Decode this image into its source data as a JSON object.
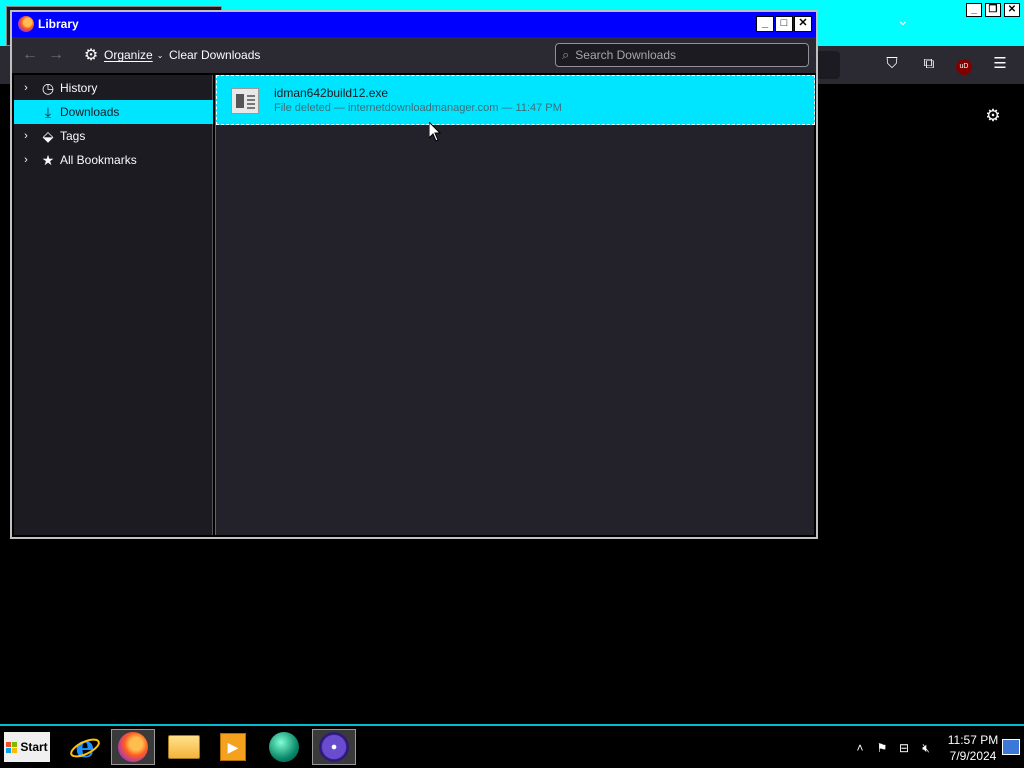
{
  "background_window": {
    "icons": [
      "chevron-down-icon",
      "pocket-icon",
      "extensions-icon",
      "ublock-icon",
      "hamburger-menu-icon",
      "gear-icon"
    ],
    "ublock_badge": "uD"
  },
  "library": {
    "title": "Library",
    "toolbar": {
      "back_icon": "←",
      "forward_icon": "→",
      "organize_label": "Organize",
      "organize_chevron": "⌄",
      "clear_downloads_label": "Clear Downloads",
      "search_placeholder": "Search Downloads"
    },
    "sidebar": {
      "items": [
        {
          "label": "History",
          "icon": "clock-icon",
          "has_twisty": true,
          "selected": false
        },
        {
          "label": "Downloads",
          "icon": "download-icon",
          "has_twisty": false,
          "selected": true
        },
        {
          "label": "Tags",
          "icon": "tag-icon",
          "has_twisty": true,
          "selected": false
        },
        {
          "label": "All Bookmarks",
          "icon": "star-icon",
          "has_twisty": true,
          "selected": false
        }
      ]
    },
    "downloads": [
      {
        "filename": "idman642build12.exe",
        "status": "File deleted — internetdownloadmanager.com — 11:47 PM"
      }
    ]
  },
  "taskbar": {
    "start_label": "Start",
    "apps": [
      "internet-explorer-icon",
      "firefox-icon",
      "file-explorer-icon",
      "media-player-icon",
      "globe-app-icon",
      "disc-app-icon"
    ],
    "clock_time": "11:57 PM",
    "clock_date": "7/9/2024",
    "colors": {
      "accent": "#00bcd4",
      "selection": "#00e5ff",
      "titlebar": "#0000ff"
    }
  }
}
